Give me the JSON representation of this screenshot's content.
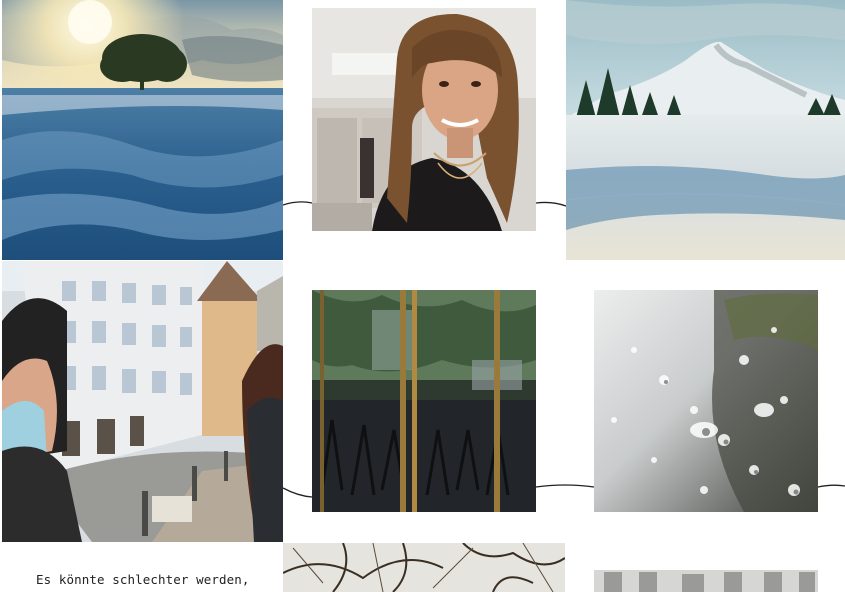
{
  "gallery": {
    "tiles": [
      {
        "icon": "photo-snow-tree-sunset"
      },
      {
        "icon": "photo-woman-portrait"
      },
      {
        "icon": "photo-snowy-hill"
      },
      {
        "icon": "photo-selfie-old-town-street"
      },
      {
        "icon": "photo-glass-door-reflection"
      },
      {
        "icon": "photo-raindrops-window"
      },
      {
        "icon": "photo-bare-branches"
      },
      {
        "icon": "photo-building-facade"
      }
    ],
    "caption": "Es könnte schlechter werden,"
  }
}
